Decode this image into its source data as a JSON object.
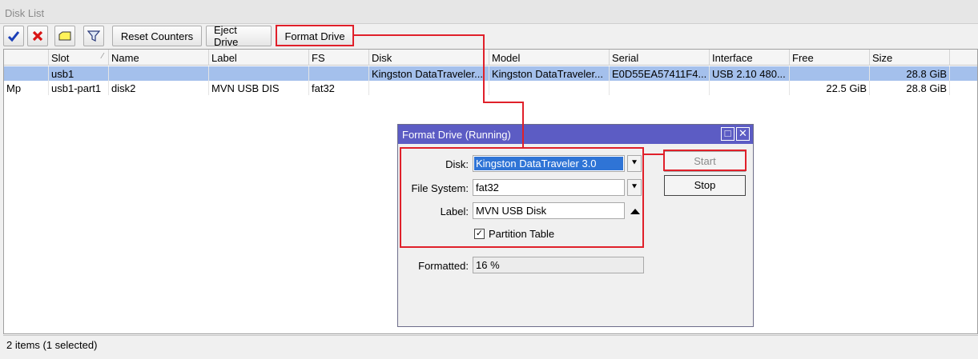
{
  "window": {
    "title": "Disk List"
  },
  "toolbar": {
    "reset_counters": "Reset Counters",
    "eject_drive": "Eject Drive",
    "format_drive": "Format Drive"
  },
  "table": {
    "columns": [
      "",
      "Slot",
      "Name",
      "Label",
      "FS",
      "Disk",
      "Model",
      "Serial",
      "Interface",
      "Free",
      "Size"
    ],
    "rows": [
      {
        "flag": "",
        "slot": "usb1",
        "name": "",
        "label": "",
        "fs": "",
        "disk": "Kingston DataTraveler...",
        "model": "Kingston DataTraveler...",
        "serial": "E0D55EA57411F4...",
        "interface": "USB 2.10 480...",
        "free": "",
        "size": "28.8 GiB"
      },
      {
        "flag": "Mp",
        "slot": "usb1-part1",
        "name": "disk2",
        "label": "MVN USB DIS",
        "fs": "fat32",
        "disk": "",
        "model": "",
        "serial": "",
        "interface": "",
        "free": "22.5 GiB",
        "size": "28.8 GiB"
      }
    ]
  },
  "status": {
    "text": "2 items (1 selected)"
  },
  "dialog": {
    "title": "Format Drive (Running)",
    "disk_label": "Disk:",
    "disk_value": "Kingston DataTraveler 3.0",
    "fs_label": "File System:",
    "fs_value": "fat32",
    "label_label": "Label:",
    "label_value": "MVN USB Disk",
    "partition_table": "Partition Table",
    "partition_checked": true,
    "formatted_label": "Formatted:",
    "formatted_value": "16 %",
    "start": "Start",
    "stop": "Stop"
  },
  "colors": {
    "selection": "#a4c0ec",
    "dialog_title": "#5c5cc4",
    "highlight": "#e0202a"
  }
}
